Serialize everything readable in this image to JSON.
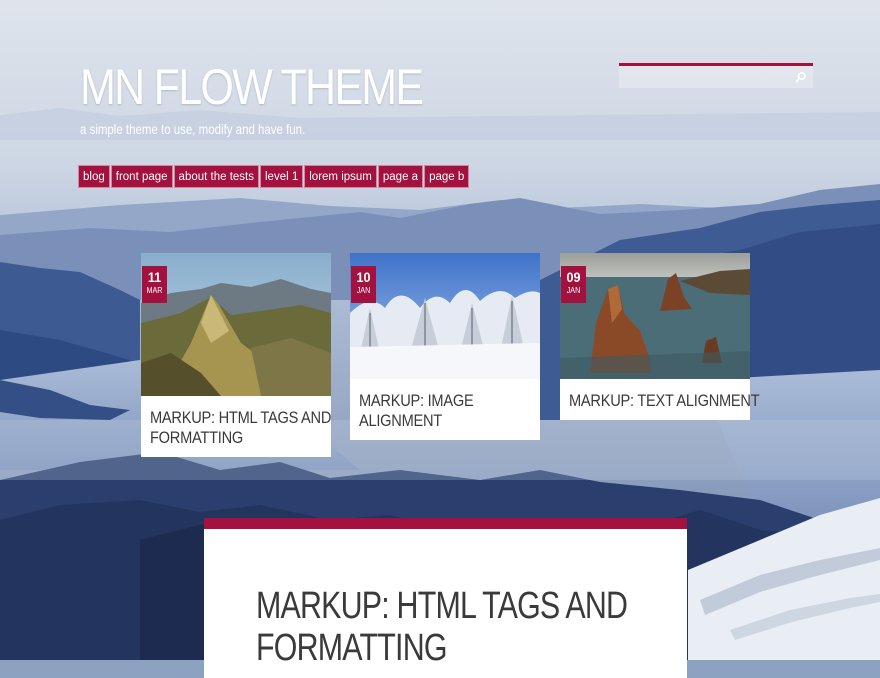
{
  "site": {
    "title": "MN FLOW THEME",
    "tagline": "a simple theme to use, modify and have fun."
  },
  "search": {
    "value": "",
    "placeholder": ""
  },
  "nav": {
    "items": [
      {
        "label": "blog"
      },
      {
        "label": "front page"
      },
      {
        "label": "about the tests"
      },
      {
        "label": "level 1"
      },
      {
        "label": "lorem ipsum"
      },
      {
        "label": "page a"
      },
      {
        "label": "page b"
      }
    ]
  },
  "posts": [
    {
      "day": "11",
      "month": "MAR",
      "title_line1": "MARKUP: HTML TAGS AND",
      "title_line2": "FORMATTING"
    },
    {
      "day": "10",
      "month": "JAN",
      "title_line1": "MARKUP: IMAGE",
      "title_line2": "ALIGNMENT"
    },
    {
      "day": "09",
      "month": "JAN",
      "title_line1": "MARKUP: TEXT ALIGNMENT",
      "title_line2": ""
    }
  ],
  "article": {
    "title_line1": "MARKUP: HTML TAGS AND",
    "title_line2": "FORMATTING"
  },
  "colors": {
    "accent": "#a3113f",
    "card_bg": "#ffffff",
    "text": "#3a3a3a"
  },
  "icons": {
    "search": "magnifier-icon"
  }
}
